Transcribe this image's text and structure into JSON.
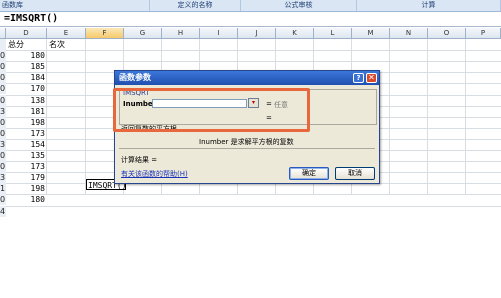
{
  "ribbon": {
    "groups": [
      "函数库",
      "定义的名称",
      "公式审核",
      "计算"
    ]
  },
  "formula_bar": {
    "text": "=IMSQRT()"
  },
  "sheet": {
    "columns": [
      "D",
      "E",
      "F",
      "G",
      "H",
      "I",
      "J",
      "K",
      "L",
      "M",
      "N",
      "O",
      "P"
    ],
    "active_column": "F",
    "header_row": {
      "D": "总分",
      "E": "名次"
    },
    "row_numbers": [
      "",
      "",
      "0",
      "0",
      "0",
      "0",
      "0",
      "3",
      "0",
      "0",
      "3",
      "0",
      "0",
      "3",
      "1",
      "0",
      "4"
    ],
    "values": [
      "180",
      "185",
      "184",
      "170",
      "138",
      "181",
      "198",
      "173",
      "154",
      "135",
      "173",
      "179",
      "198",
      "180"
    ],
    "editing_cell": "IMSQRT()"
  },
  "dialog": {
    "title": "函数参数",
    "help_glyph": "?",
    "close_glyph": "✕",
    "function_name": "IMSQRT",
    "arg_label": "Inumber",
    "arg_button_glyph": "▾",
    "arg_eq": "=",
    "arg_type": "任意",
    "result_eq": "=",
    "description": "返回复数的平方根",
    "arg_description": "Inumber  是求解平方根的复数",
    "result_label": "计算结果 =",
    "help_link": "有关该函数的帮助(H)",
    "ok_label": "确定",
    "cancel_label": "取消"
  }
}
